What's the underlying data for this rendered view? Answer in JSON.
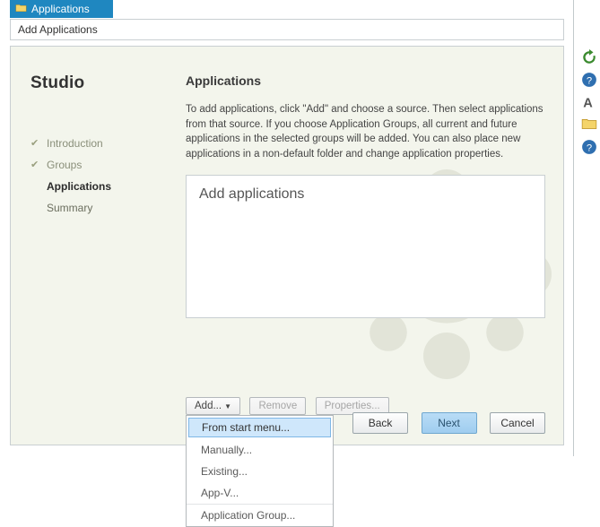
{
  "tab": {
    "label": "Applications"
  },
  "window": {
    "title": "Add Applications"
  },
  "brand": "Studio",
  "steps": {
    "introduction": "Introduction",
    "groups": "Groups",
    "applications": "Applications",
    "summary": "Summary"
  },
  "content": {
    "heading": "Applications",
    "description": "To add applications, click \"Add\" and choose a source. Then select applications from that source. If you choose Application Groups, all current and future applications in the selected groups will be added. You can also place new applications in a non-default folder and change application properties.",
    "box_placeholder": "Add applications"
  },
  "buttons": {
    "add": "Add...",
    "remove": "Remove",
    "properties": "Properties..."
  },
  "menu": {
    "start": "From start menu...",
    "manually": "Manually...",
    "existing": "Existing...",
    "appv": "App-V...",
    "appgroup": "Application Group..."
  },
  "footer": {
    "back": "Back",
    "next": "Next",
    "cancel": "Cancel"
  }
}
